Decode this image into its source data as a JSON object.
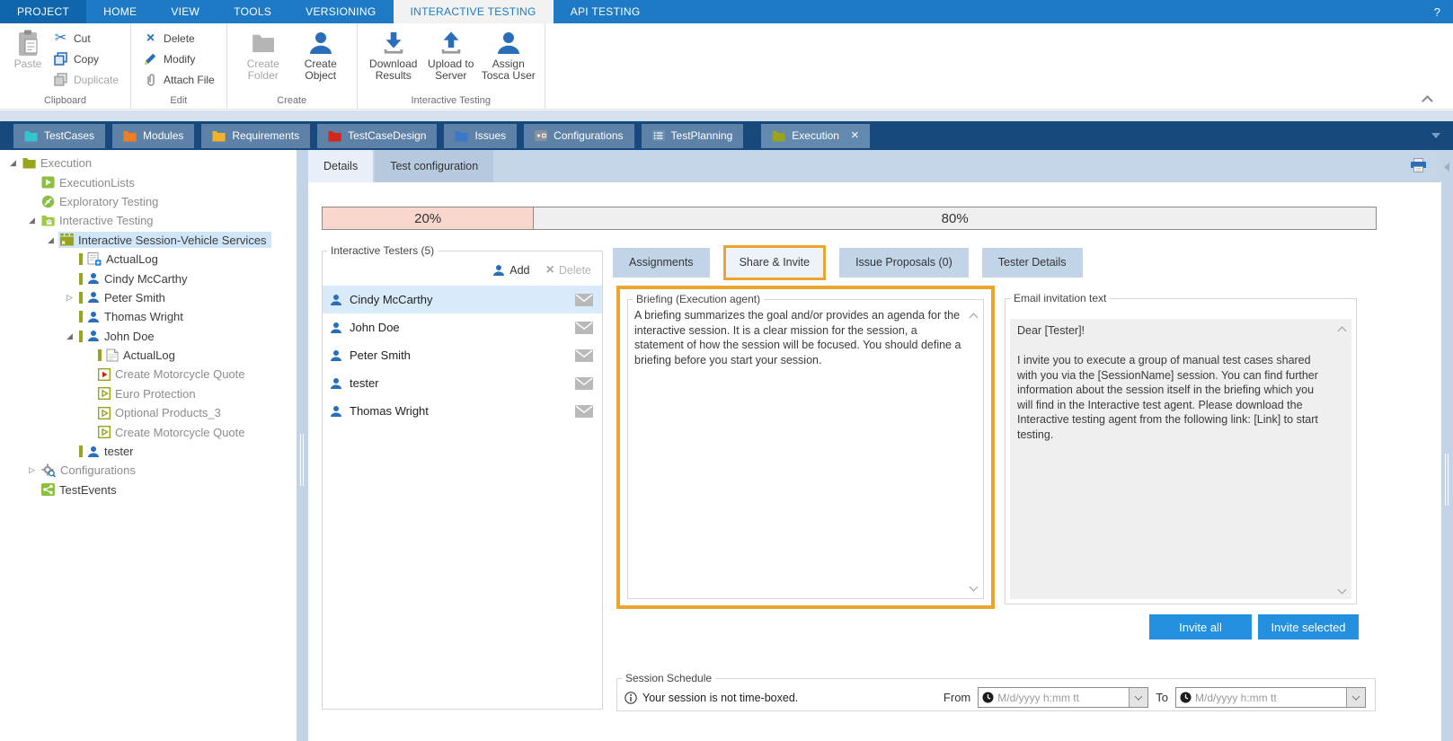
{
  "menubar": {
    "items": [
      {
        "label": "PROJECT",
        "emphasis": true
      },
      {
        "label": "HOME"
      },
      {
        "label": "VIEW"
      },
      {
        "label": "TOOLS"
      },
      {
        "label": "VERSIONING"
      },
      {
        "label": "INTERACTIVE TESTING",
        "active": true
      },
      {
        "label": "API TESTING"
      }
    ],
    "help_label": "?"
  },
  "ribbon": {
    "groups": [
      {
        "label": "Clipboard",
        "big": [
          {
            "label": "Paste",
            "icon": "paste-clipboard-icon",
            "disabled": true,
            "narrow": true
          }
        ],
        "small": [
          {
            "label": "Cut",
            "icon": "scissors-icon"
          },
          {
            "label": "Copy",
            "icon": "copy-icon"
          },
          {
            "label": "Duplicate",
            "icon": "duplicate-icon",
            "disabled": true
          }
        ]
      },
      {
        "label": "Edit",
        "small": [
          {
            "label": "Delete",
            "icon": "delete-x-icon"
          },
          {
            "label": "Modify",
            "icon": "pencil-icon"
          },
          {
            "label": "Attach File",
            "icon": "paperclip-icon"
          }
        ]
      },
      {
        "label": "Create",
        "big": [
          {
            "label": "Create Folder",
            "icon": "folder-gray-icon",
            "disabled": true
          },
          {
            "label": "Create Object",
            "icon": "person-big-icon"
          }
        ]
      },
      {
        "label": "Interactive Testing",
        "big": [
          {
            "label": "Download Results",
            "icon": "download-icon"
          },
          {
            "label": "Upload to Server",
            "icon": "upload-icon"
          },
          {
            "label": "Assign Tosca User",
            "icon": "person-big-icon"
          }
        ]
      }
    ]
  },
  "workspace_tabs": [
    {
      "label": "TestCases",
      "icon": "folder-icon",
      "color": "#35c4cf"
    },
    {
      "label": "Modules",
      "icon": "folder-icon",
      "color": "#ef7d23"
    },
    {
      "label": "Requirements",
      "icon": "folder-icon",
      "color": "#f0b32a"
    },
    {
      "label": "TestCaseDesign",
      "icon": "folder-icon",
      "color": "#d6261b"
    },
    {
      "label": "Issues",
      "icon": "folder-icon",
      "color": "#3b78c9"
    },
    {
      "label": "Configurations",
      "icon": "config-icon"
    },
    {
      "label": "TestPlanning",
      "icon": "planning-icon"
    },
    {
      "label": "Execution",
      "icon": "folder-icon",
      "color": "#97a41c",
      "active": true,
      "close_label": "×",
      "gap": true
    }
  ],
  "tree": [
    {
      "label": "Execution",
      "depth": 0,
      "expander": "expanded",
      "icon": "folder-olive-icon",
      "muted": true
    },
    {
      "label": "ExecutionLists",
      "depth": 1,
      "expander": "none",
      "icon": "execution-list-icon",
      "muted": true
    },
    {
      "label": "Exploratory Testing",
      "depth": 1,
      "expander": "none",
      "icon": "exploratory-icon",
      "muted": true
    },
    {
      "label": "Interactive Testing",
      "depth": 1,
      "expander": "expanded",
      "icon": "interactive-testing-icon",
      "muted": true
    },
    {
      "label": "Interactive Session-Vehicle Services",
      "depth": 2,
      "expander": "expanded",
      "icon": "session-icon",
      "selected": true
    },
    {
      "label": "ActualLog",
      "depth": 3,
      "expander": "none",
      "icon": "log-add-icon",
      "bar": true
    },
    {
      "label": "Cindy McCarthy",
      "depth": 3,
      "expander": "none",
      "icon": "person-icon",
      "bar": true
    },
    {
      "label": "Peter Smith",
      "depth": 3,
      "expander": "collapsed",
      "icon": "person-icon",
      "bar": true
    },
    {
      "label": "Thomas Wright",
      "depth": 3,
      "expander": "none",
      "icon": "person-icon",
      "bar": true
    },
    {
      "label": "John Doe",
      "depth": 3,
      "expander": "expanded",
      "icon": "person-icon",
      "bar": true
    },
    {
      "label": "ActualLog",
      "depth": 4,
      "expander": "none",
      "icon": "log-icon",
      "bar": true
    },
    {
      "label": "Create Motorcycle Quote",
      "depth": 4,
      "expander": "none",
      "icon": "play-red-icon",
      "muted": true
    },
    {
      "label": "Euro Protection",
      "depth": 4,
      "expander": "none",
      "icon": "play-olive-icon",
      "muted": true
    },
    {
      "label": "Optional Products_3",
      "depth": 4,
      "expander": "none",
      "icon": "play-olive-icon",
      "muted": true
    },
    {
      "label": "Create Motorcycle Quote",
      "depth": 4,
      "expander": "none",
      "icon": "play-olive-icon",
      "muted": true
    },
    {
      "label": "tester",
      "depth": 3,
      "expander": "none",
      "icon": "person-icon",
      "bar": true
    },
    {
      "label": "Configurations",
      "depth": 1,
      "expander": "collapsed",
      "icon": "configurations-gear-icon",
      "muted": true
    },
    {
      "label": "TestEvents",
      "depth": 1,
      "expander": "none",
      "icon": "test-events-icon"
    }
  ],
  "detail_tabs": [
    {
      "label": "Details",
      "active": true
    },
    {
      "label": "Test configuration"
    }
  ],
  "progress": {
    "segments": [
      {
        "label": "20%",
        "value": 20,
        "color": "#f9d7cc"
      },
      {
        "label": "80%",
        "value": 80,
        "color": "#efefef"
      }
    ]
  },
  "testers_panel": {
    "title": "Interactive Testers (5)",
    "add_label": "Add",
    "delete_label": "Delete",
    "testers": [
      {
        "name": "Cindy McCarthy",
        "selected": true
      },
      {
        "name": "John Doe"
      },
      {
        "name": "Peter Smith"
      },
      {
        "name": "tester"
      },
      {
        "name": "Thomas Wright"
      }
    ]
  },
  "session_tabs": [
    {
      "label": "Assignments"
    },
    {
      "label": "Share & Invite",
      "active": true,
      "highlighted": true
    },
    {
      "label": "Issue Proposals (0)"
    },
    {
      "label": "Tester Details"
    }
  ],
  "briefing": {
    "title": "Briefing (Execution agent)",
    "text": "A briefing summarizes the goal and/or provides an agenda for the interactive session. It is a clear mission for the session, a statement of how the session will be focused. You should define a briefing before you start your session."
  },
  "email": {
    "title": "Email invitation text",
    "text": "Dear [Tester]!\n\nI invite you to execute a group of manual test cases shared with you via the [SessionName] session. You can find further information about the session itself in the briefing which you will find in the Interactive test agent. Please download the Interactive testing agent from the following link: [Link] to start testing."
  },
  "actions": {
    "invite_all": "Invite all",
    "invite_selected": "Invite selected"
  },
  "schedule": {
    "title": "Session Schedule",
    "info": "Your session is not time-boxed.",
    "from_label": "From",
    "to_label": "To",
    "from_placeholder": "M/d/yyyy h:mm tt",
    "to_placeholder": "M/d/yyyy h:mm tt"
  },
  "colors": {
    "accent_orange": "#eba52e",
    "menubar_blue": "#1e7ac4",
    "tabstrip_navy": "#17497e",
    "invite_blue": "#2290df",
    "olive": "#97a41c"
  }
}
